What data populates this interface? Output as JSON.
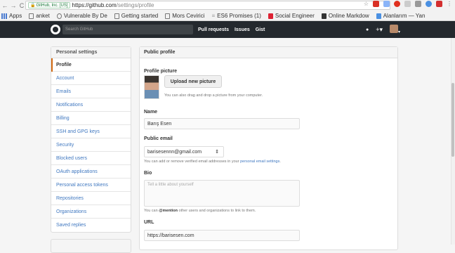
{
  "browser": {
    "secure_badge": "GitHub, Inc. [US]",
    "url_host": "https://github.com",
    "url_path": "/settings/profile",
    "bookmarks": [
      "Apps",
      "anket",
      "Vulnerable By De",
      "Getting started",
      "Mors Cevirici",
      "ES6 Promises (1)",
      "Social Engineer",
      "Online Markdow",
      "Alanlarım — Yan"
    ]
  },
  "header": {
    "search_placeholder": "Search GitHub",
    "nav": [
      "Pull requests",
      "Issues",
      "Gist"
    ],
    "bell": "🔔",
    "plus": "+▾",
    "avatar_caret": "▾"
  },
  "sidebar": {
    "title": "Personal settings",
    "items": [
      "Profile",
      "Account",
      "Emails",
      "Notifications",
      "Billing",
      "SSH and GPG keys",
      "Security",
      "Blocked users",
      "OAuth applications",
      "Personal access tokens",
      "Repositories",
      "Organizations",
      "Saved replies"
    ]
  },
  "main": {
    "title": "Public profile",
    "picture_label": "Profile picture",
    "upload_button": "Upload new picture",
    "upload_hint": "You can also drag and drop a picture from your computer.",
    "name_label": "Name",
    "name_value": "Barış Esen",
    "email_label": "Public email",
    "email_value": "barisesennn@gmail.com",
    "email_hint_prefix": "You can add or remove verified email addresses in your ",
    "email_hint_link": "personal email settings",
    "email_hint_suffix": ".",
    "bio_label": "Bio",
    "bio_placeholder": "Tell a little about yourself",
    "bio_hint_prefix": "You can ",
    "bio_hint_bold": "@mention",
    "bio_hint_suffix": " other users and organizations to link to them.",
    "url_label": "URL",
    "url_value": "https://barisesen.com"
  }
}
